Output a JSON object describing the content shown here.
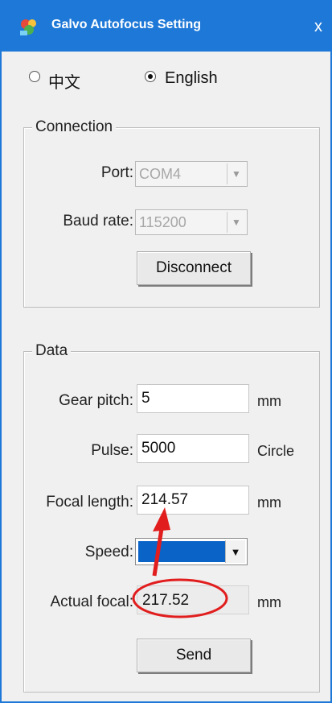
{
  "window": {
    "title": "Galvo Autofocus Setting",
    "close_label": "x"
  },
  "language": {
    "option_chinese": "中文",
    "option_english": "English",
    "selected": "English"
  },
  "connection": {
    "legend": "Connection",
    "port_label": "Port:",
    "port_value": "COM4",
    "baud_label": "Baud rate:",
    "baud_value": "115200",
    "disconnect_label": "Disconnect"
  },
  "data": {
    "legend": "Data",
    "gear_pitch_label": "Gear pitch:",
    "gear_pitch_value": "5",
    "gear_pitch_unit": "mm",
    "pulse_label": "Pulse:",
    "pulse_value": "5000",
    "pulse_unit": "Circle",
    "focal_length_label": "Focal length:",
    "focal_length_value": "214.57",
    "focal_length_unit": "mm",
    "speed_label": "Speed:",
    "actual_focal_label": "Actual focal:",
    "actual_focal_value": "217.52",
    "actual_focal_unit": "mm",
    "send_label": "Send"
  },
  "colors": {
    "titlebar": "#1e78d7",
    "annotation": "#e11d1d",
    "selection": "#0a64c8"
  },
  "icons": {
    "app": "galvo-app-icon",
    "dropdown": "chevron-down-icon"
  }
}
